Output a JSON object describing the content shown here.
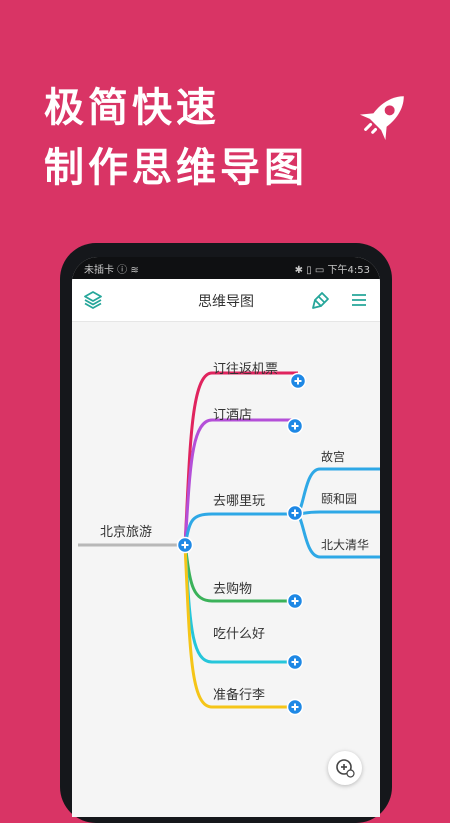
{
  "promo": {
    "line1": "极简快速",
    "line2": "制作思维导图"
  },
  "statusbar": {
    "left": "未插卡 ⓘ ≋",
    "right": "✱ ▯ ▭ 下午4:53"
  },
  "header": {
    "title": "思维导图"
  },
  "mindmap": {
    "root": "北京旅游",
    "branches": [
      {
        "label": "订往返机票",
        "color": "#e0245e"
      },
      {
        "label": "订酒店",
        "color": "#b44fd8"
      },
      {
        "label": "去哪里玩",
        "color": "#2ea8e6"
      },
      {
        "label": "去购物",
        "color": "#3bb25a"
      },
      {
        "label": "吃什么好",
        "color": "#26c6da"
      },
      {
        "label": "准备行李",
        "color": "#f5c518"
      }
    ],
    "sub": [
      "故宫",
      "颐和园",
      "北大清华"
    ]
  },
  "colors": {
    "background": "#d93465",
    "expand_button": "#1e88e5",
    "root_line": "#b8b8b8"
  }
}
